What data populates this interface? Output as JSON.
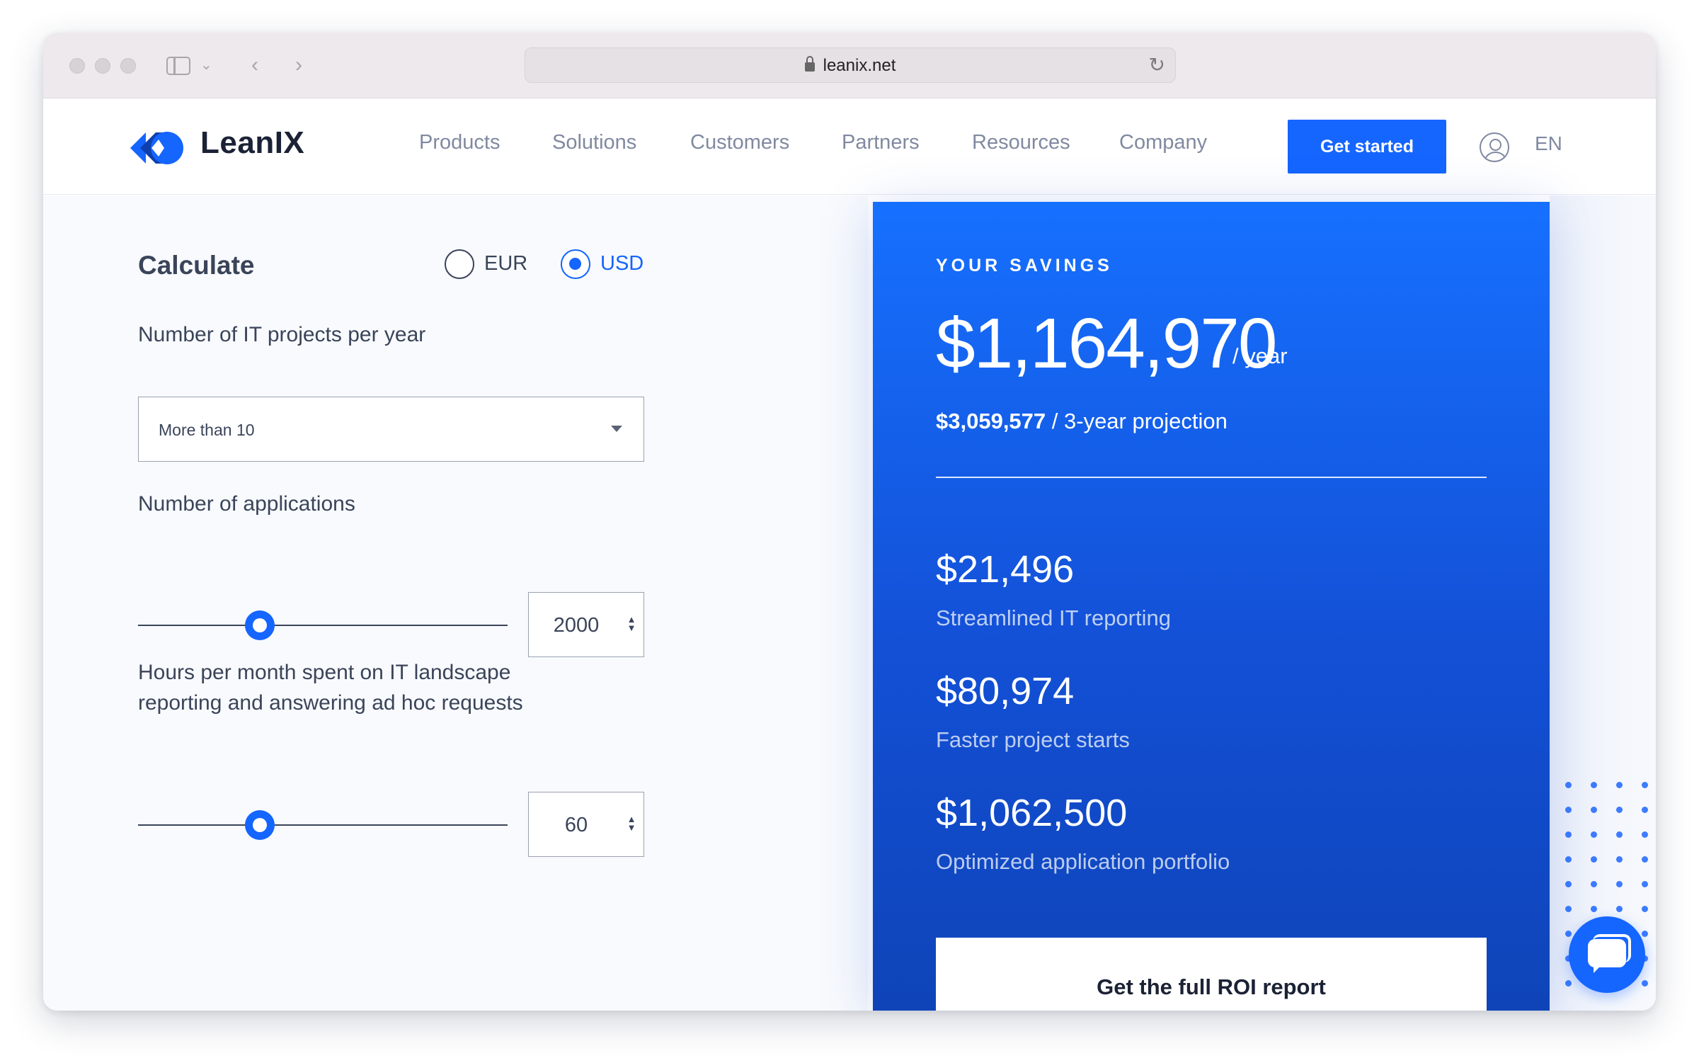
{
  "browser": {
    "url": "leanix.net"
  },
  "nav": {
    "brand": "LeanIX",
    "items": [
      "Products",
      "Solutions",
      "Customers",
      "Partners",
      "Resources",
      "Company"
    ],
    "cta": "Get started",
    "language": "EN"
  },
  "calculator": {
    "title": "Calculate",
    "currency": {
      "options": [
        "EUR",
        "USD"
      ],
      "selected": "USD"
    },
    "projects": {
      "label": "Number of IT projects per year",
      "value": "More than 10"
    },
    "applications": {
      "label": "Number of applications",
      "value": "2000",
      "slider_fraction": 0.33
    },
    "hours": {
      "label_line1": "Hours per month spent on IT landscape",
      "label_line2": "reporting and answering ad hoc requests",
      "value": "60",
      "slider_fraction": 0.33
    }
  },
  "savings": {
    "eyebrow": "YOUR SAVINGS",
    "yearly_total": "$1,164,970",
    "yearly_unit": "/ year",
    "projection_value": "$3,059,577",
    "projection_label": "/ 3-year projection",
    "items": [
      {
        "value": "$21,496",
        "label": "Streamlined IT reporting"
      },
      {
        "value": "$80,974",
        "label": "Faster project starts"
      },
      {
        "value": "$1,062,500",
        "label": "Optimized application portfolio"
      }
    ],
    "report_button": "Get the full ROI report"
  },
  "colors": {
    "accent": "#1565ff",
    "text": "#3a4459",
    "muted": "#8089a0"
  },
  "icons": [
    "lock-icon",
    "reload-icon",
    "sidebar-toggle-icon",
    "chevron-left-icon",
    "chevron-right-icon",
    "user-icon",
    "chat-icon",
    "chevron-down-icon"
  ]
}
